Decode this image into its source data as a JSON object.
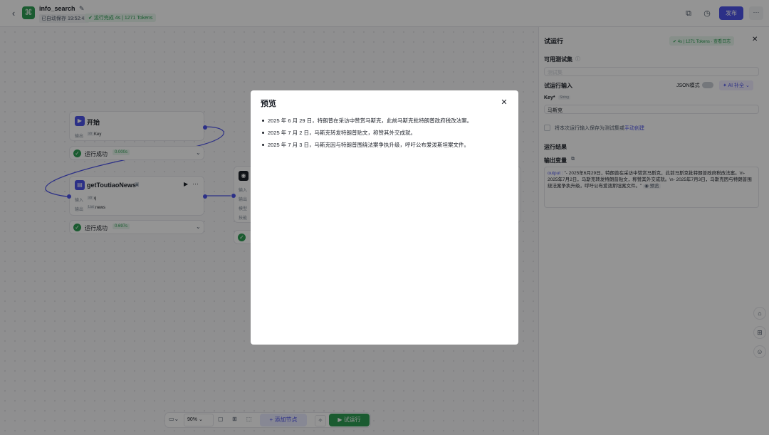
{
  "header": {
    "back_icon": "chevron-left-icon",
    "app_icon": "workflow-icon",
    "title": "info_search",
    "autosave": "已自动保存 19:52:43",
    "run_status": "运行完成 4s | 1271 Tokens",
    "publish_label": "发布",
    "more_label": "···"
  },
  "nodes": {
    "start": {
      "title": "开始",
      "out_label": "输出",
      "out_tag": "str",
      "out_value": "Key",
      "status": "运行成功",
      "time": "0.000s"
    },
    "toutiao": {
      "title": "getToutiaoNews",
      "in_label": "输入",
      "in_tag": "str",
      "in_value": "q",
      "out_label": "输出",
      "out_tag": "List",
      "out_value": "news",
      "status": "运行成功",
      "time": "0.697s"
    },
    "llm": {
      "rows": [
        "输入",
        "输出",
        "模型",
        "技能"
      ]
    }
  },
  "toolbar": {
    "zoom": "90%",
    "add_node": "添加节点",
    "trial_run": "试运行"
  },
  "panel": {
    "title": "试运行",
    "badge": "4s | 1271 Tokens · 查看日志",
    "testset_label": "可用测试集",
    "testset_placeholder": "测试集",
    "input_label": "试运行输入",
    "json_mode": "JSON模式",
    "ai_fill": "AI 补全",
    "key_label": "Key*",
    "key_type": "String",
    "key_value": "马斯克",
    "save_text": "将本次运行输入保存为测试集或",
    "save_link": "手动创建",
    "result_label": "运行结果",
    "output_var": "输出变量",
    "output_key": "output :",
    "output_text": "\"- 2025年6月29日，特朗普在采访中赞赏马斯克，此前马斯克批特朗普政府税改法案。\\n- 2025年7月2日，马斯克转发特朗普贴文，称赞其外交成就。\\n- 2025年7月3日，马斯克因与特朗普围绕法案争执升级，呼吁公布爱泼斯坦案文件。\"",
    "preview": "预览"
  },
  "modal": {
    "title": "预览",
    "items": [
      "2025 年 6 月 29 日，特朗普在采访中赞赏马斯克，此前马斯克批特朗普政府税改法案。",
      "2025 年 7 月 2 日，马斯克转发特朗普贴文，称赞其外交成就。",
      "2025 年 7 月 3 日，马斯克因与特朗普围绕法案争执升级，呼吁公布爱泼斯坦案文件。"
    ]
  },
  "colors": {
    "accent": "#4d53e8",
    "success": "#2e9e53",
    "overlay": "rgba(0,0,0,0.42)"
  }
}
